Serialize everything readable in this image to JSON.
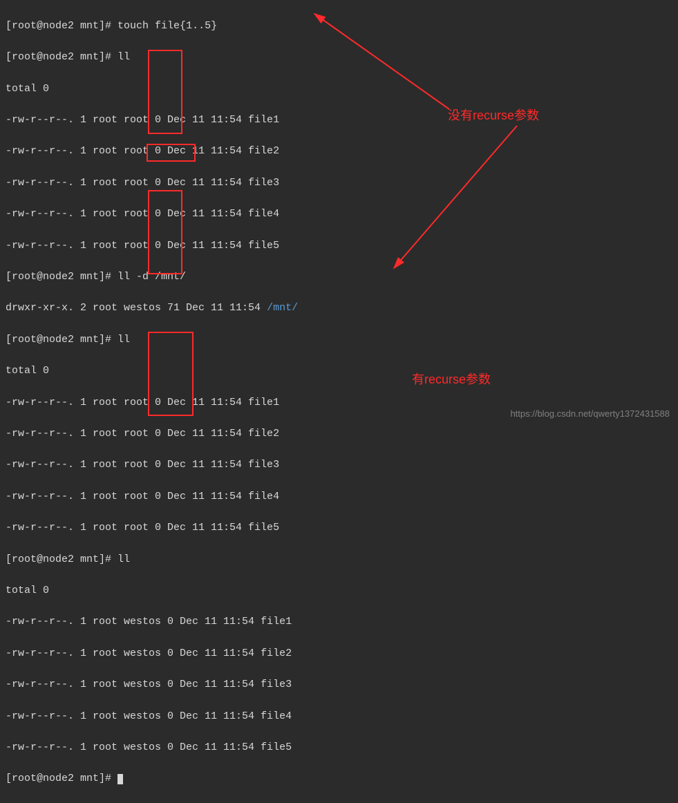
{
  "prompt": "[root@node2 mnt]#",
  "commands": {
    "touch": "touch file{1..5}",
    "ll": "ll",
    "lld": "ll -d /mnt/"
  },
  "total": "total 0",
  "rows_root": [
    "-rw-r--r--. 1 root root 0 Dec 11 11:54 file1",
    "-rw-r--r--. 1 root root 0 Dec 11 11:54 file2",
    "-rw-r--r--. 1 root root 0 Dec 11 11:54 file3",
    "-rw-r--r--. 1 root root 0 Dec 11 11:54 file4",
    "-rw-r--r--. 1 root root 0 Dec 11 11:54 file5"
  ],
  "dir_row": {
    "left": "drwxr-xr-x. 2 root westos 71 Dec 11 11:54 ",
    "path": "/mnt/"
  },
  "rows_westos": [
    "-rw-r--r--. 1 root westos 0 Dec 11 11:54 file1",
    "-rw-r--r--. 1 root westos 0 Dec 11 11:54 file2",
    "-rw-r--r--. 1 root westos 0 Dec 11 11:54 file3",
    "-rw-r--r--. 1 root westos 0 Dec 11 11:54 file4",
    "-rw-r--r--. 1 root westos 0 Dec 11 11:54 file5"
  ],
  "last_prompt": "[root@node2 mnt]# ",
  "annotations": {
    "no_recurse": "没有recurse参数",
    "has_recurse": "有recurse参数"
  },
  "watermark": "https://blog.csdn.net/qwerty1372431588",
  "colors": {
    "bg": "#2b2b2b",
    "fg": "#d8d8d8",
    "red": "#ff2a2a",
    "blue": "#5a9bd5"
  }
}
